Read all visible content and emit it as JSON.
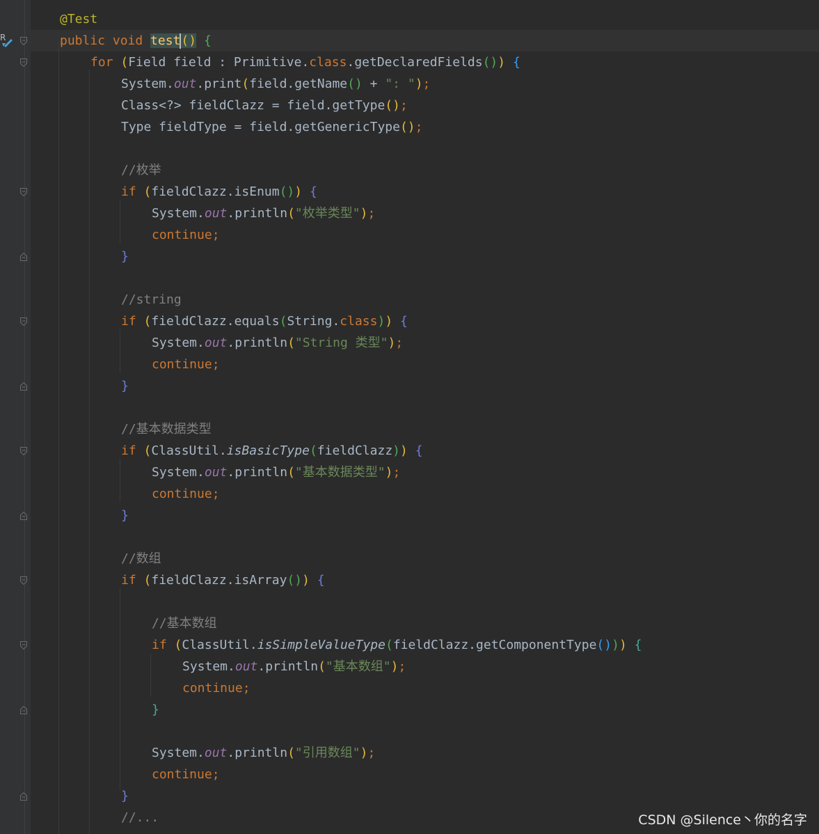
{
  "editor": {
    "lines": [
      {
        "tokens": [
          {
            "t": "@Test",
            "c": "ann"
          }
        ]
      },
      {
        "tokens": [
          {
            "t": "public ",
            "c": "kw"
          },
          {
            "t": "void ",
            "c": "kw"
          },
          {
            "t": "test",
            "c": "fn hl"
          },
          {
            "t": "()",
            "c": "b1 hl"
          },
          {
            "t": " ",
            "c": ""
          },
          {
            "t": "{",
            "c": "b2"
          }
        ]
      },
      {
        "tokens": [
          {
            "t": "for ",
            "c": "kw"
          },
          {
            "t": "(",
            "c": "b1"
          },
          {
            "t": "Field field : Primitive.",
            "c": ""
          },
          {
            "t": "class",
            "c": "kw"
          },
          {
            "t": ".getDeclaredFields",
            "c": ""
          },
          {
            "t": "()",
            "c": "b2"
          },
          {
            "t": ")",
            "c": "b1"
          },
          {
            "t": " ",
            "c": ""
          },
          {
            "t": "{",
            "c": "b3"
          }
        ]
      },
      {
        "tokens": [
          {
            "t": "System.",
            "c": ""
          },
          {
            "t": "out",
            "c": "static"
          },
          {
            "t": ".print",
            "c": ""
          },
          {
            "t": "(",
            "c": "b1"
          },
          {
            "t": "field.getName",
            "c": ""
          },
          {
            "t": "()",
            "c": "b2"
          },
          {
            "t": " + ",
            "c": ""
          },
          {
            "t": "\": \"",
            "c": "str"
          },
          {
            "t": ")",
            "c": "b1"
          },
          {
            "t": ";",
            "c": "kw"
          }
        ]
      },
      {
        "tokens": [
          {
            "t": "Class<?> fieldClazz = field.getType",
            "c": ""
          },
          {
            "t": "()",
            "c": "b1"
          },
          {
            "t": ";",
            "c": "kw"
          }
        ]
      },
      {
        "tokens": [
          {
            "t": "Type fieldType = field.getGenericType",
            "c": ""
          },
          {
            "t": "()",
            "c": "b1"
          },
          {
            "t": ";",
            "c": "kw"
          }
        ]
      },
      {
        "tokens": []
      },
      {
        "tokens": [
          {
            "t": "//枚举",
            "c": "cmt"
          }
        ]
      },
      {
        "tokens": [
          {
            "t": "if ",
            "c": "kw"
          },
          {
            "t": "(",
            "c": "b1"
          },
          {
            "t": "fieldClazz.isEnum",
            "c": ""
          },
          {
            "t": "()",
            "c": "b2"
          },
          {
            "t": ")",
            "c": "b1"
          },
          {
            "t": " ",
            "c": ""
          },
          {
            "t": "{",
            "c": "b4"
          }
        ]
      },
      {
        "tokens": [
          {
            "t": "System.",
            "c": ""
          },
          {
            "t": "out",
            "c": "static"
          },
          {
            "t": ".println",
            "c": ""
          },
          {
            "t": "(",
            "c": "b1"
          },
          {
            "t": "\"枚举类型\"",
            "c": "str"
          },
          {
            "t": ")",
            "c": "b1"
          },
          {
            "t": ";",
            "c": "kw"
          }
        ]
      },
      {
        "tokens": [
          {
            "t": "continue;",
            "c": "kw"
          }
        ]
      },
      {
        "tokens": [
          {
            "t": "}",
            "c": "b4"
          }
        ]
      },
      {
        "tokens": []
      },
      {
        "tokens": [
          {
            "t": "//string",
            "c": "cmt"
          }
        ]
      },
      {
        "tokens": [
          {
            "t": "if ",
            "c": "kw"
          },
          {
            "t": "(",
            "c": "b1"
          },
          {
            "t": "fieldClazz.equals",
            "c": ""
          },
          {
            "t": "(",
            "c": "b2"
          },
          {
            "t": "String.",
            "c": ""
          },
          {
            "t": "class",
            "c": "kw"
          },
          {
            "t": ")",
            "c": "b2"
          },
          {
            "t": ")",
            "c": "b1"
          },
          {
            "t": " ",
            "c": ""
          },
          {
            "t": "{",
            "c": "b4"
          }
        ]
      },
      {
        "tokens": [
          {
            "t": "System.",
            "c": ""
          },
          {
            "t": "out",
            "c": "static"
          },
          {
            "t": ".println",
            "c": ""
          },
          {
            "t": "(",
            "c": "b1"
          },
          {
            "t": "\"String 类型\"",
            "c": "str"
          },
          {
            "t": ")",
            "c": "b1"
          },
          {
            "t": ";",
            "c": "kw"
          }
        ]
      },
      {
        "tokens": [
          {
            "t": "continue;",
            "c": "kw"
          }
        ]
      },
      {
        "tokens": [
          {
            "t": "}",
            "c": "b4"
          }
        ]
      },
      {
        "tokens": []
      },
      {
        "tokens": [
          {
            "t": "//基本数据类型",
            "c": "cmt"
          }
        ]
      },
      {
        "tokens": [
          {
            "t": "if ",
            "c": "kw"
          },
          {
            "t": "(",
            "c": "b1"
          },
          {
            "t": "ClassUtil.",
            "c": ""
          },
          {
            "t": "isBasicType",
            "c": "italic-m"
          },
          {
            "t": "(",
            "c": "b2"
          },
          {
            "t": "fieldClazz",
            "c": ""
          },
          {
            "t": ")",
            "c": "b2"
          },
          {
            "t": ")",
            "c": "b1"
          },
          {
            "t": " ",
            "c": ""
          },
          {
            "t": "{",
            "c": "b4"
          }
        ]
      },
      {
        "tokens": [
          {
            "t": "System.",
            "c": ""
          },
          {
            "t": "out",
            "c": "static"
          },
          {
            "t": ".println",
            "c": ""
          },
          {
            "t": "(",
            "c": "b1"
          },
          {
            "t": "\"基本数据类型\"",
            "c": "str"
          },
          {
            "t": ")",
            "c": "b1"
          },
          {
            "t": ";",
            "c": "kw"
          }
        ]
      },
      {
        "tokens": [
          {
            "t": "continue;",
            "c": "kw"
          }
        ]
      },
      {
        "tokens": [
          {
            "t": "}",
            "c": "b4"
          }
        ]
      },
      {
        "tokens": []
      },
      {
        "tokens": [
          {
            "t": "//数组",
            "c": "cmt"
          }
        ]
      },
      {
        "tokens": [
          {
            "t": "if ",
            "c": "kw"
          },
          {
            "t": "(",
            "c": "b1"
          },
          {
            "t": "fieldClazz.isArray",
            "c": ""
          },
          {
            "t": "()",
            "c": "b2"
          },
          {
            "t": ")",
            "c": "b1"
          },
          {
            "t": " ",
            "c": ""
          },
          {
            "t": "{",
            "c": "b4"
          }
        ]
      },
      {
        "tokens": []
      },
      {
        "tokens": [
          {
            "t": "//基本数组",
            "c": "cmt"
          }
        ]
      },
      {
        "tokens": [
          {
            "t": "if ",
            "c": "kw"
          },
          {
            "t": "(",
            "c": "b1"
          },
          {
            "t": "ClassUtil.",
            "c": ""
          },
          {
            "t": "isSimpleValueType",
            "c": "italic-m"
          },
          {
            "t": "(",
            "c": "b2"
          },
          {
            "t": "fieldClazz.getComponentType",
            "c": ""
          },
          {
            "t": "()",
            "c": "b3"
          },
          {
            "t": ")",
            "c": "b2"
          },
          {
            "t": ")",
            "c": "b1"
          },
          {
            "t": " ",
            "c": ""
          },
          {
            "t": "{",
            "c": "b6"
          }
        ]
      },
      {
        "tokens": [
          {
            "t": "System.",
            "c": ""
          },
          {
            "t": "out",
            "c": "static"
          },
          {
            "t": ".println",
            "c": ""
          },
          {
            "t": "(",
            "c": "b1"
          },
          {
            "t": "\"基本数组\"",
            "c": "str"
          },
          {
            "t": ")",
            "c": "b1"
          },
          {
            "t": ";",
            "c": "kw"
          }
        ]
      },
      {
        "tokens": [
          {
            "t": "continue;",
            "c": "kw"
          }
        ]
      },
      {
        "tokens": [
          {
            "t": "}",
            "c": "b6"
          }
        ]
      },
      {
        "tokens": []
      },
      {
        "tokens": [
          {
            "t": "System.",
            "c": ""
          },
          {
            "t": "out",
            "c": "static"
          },
          {
            "t": ".println",
            "c": ""
          },
          {
            "t": "(",
            "c": "b1"
          },
          {
            "t": "\"引用数组\"",
            "c": "str"
          },
          {
            "t": ")",
            "c": "b1"
          },
          {
            "t": ";",
            "c": "kw"
          }
        ]
      },
      {
        "tokens": [
          {
            "t": "continue;",
            "c": "kw"
          }
        ]
      },
      {
        "tokens": [
          {
            "t": "}",
            "c": "b4"
          }
        ]
      },
      {
        "tokens": [
          {
            "t": "//...",
            "c": "cmt"
          }
        ]
      }
    ]
  },
  "gutter": {
    "run_icon": "run-test-icon"
  },
  "watermark": {
    "text": "CSDN @Silence丶你的名字"
  },
  "colors": {
    "background": "#2b2b2b",
    "gutter": "#313335",
    "keyword": "#cc7832",
    "annotation": "#bbb529",
    "function": "#ffc66d",
    "static_field": "#9876aa",
    "string": "#6a8759",
    "comment": "#808080",
    "text": "#a9b7c6"
  }
}
